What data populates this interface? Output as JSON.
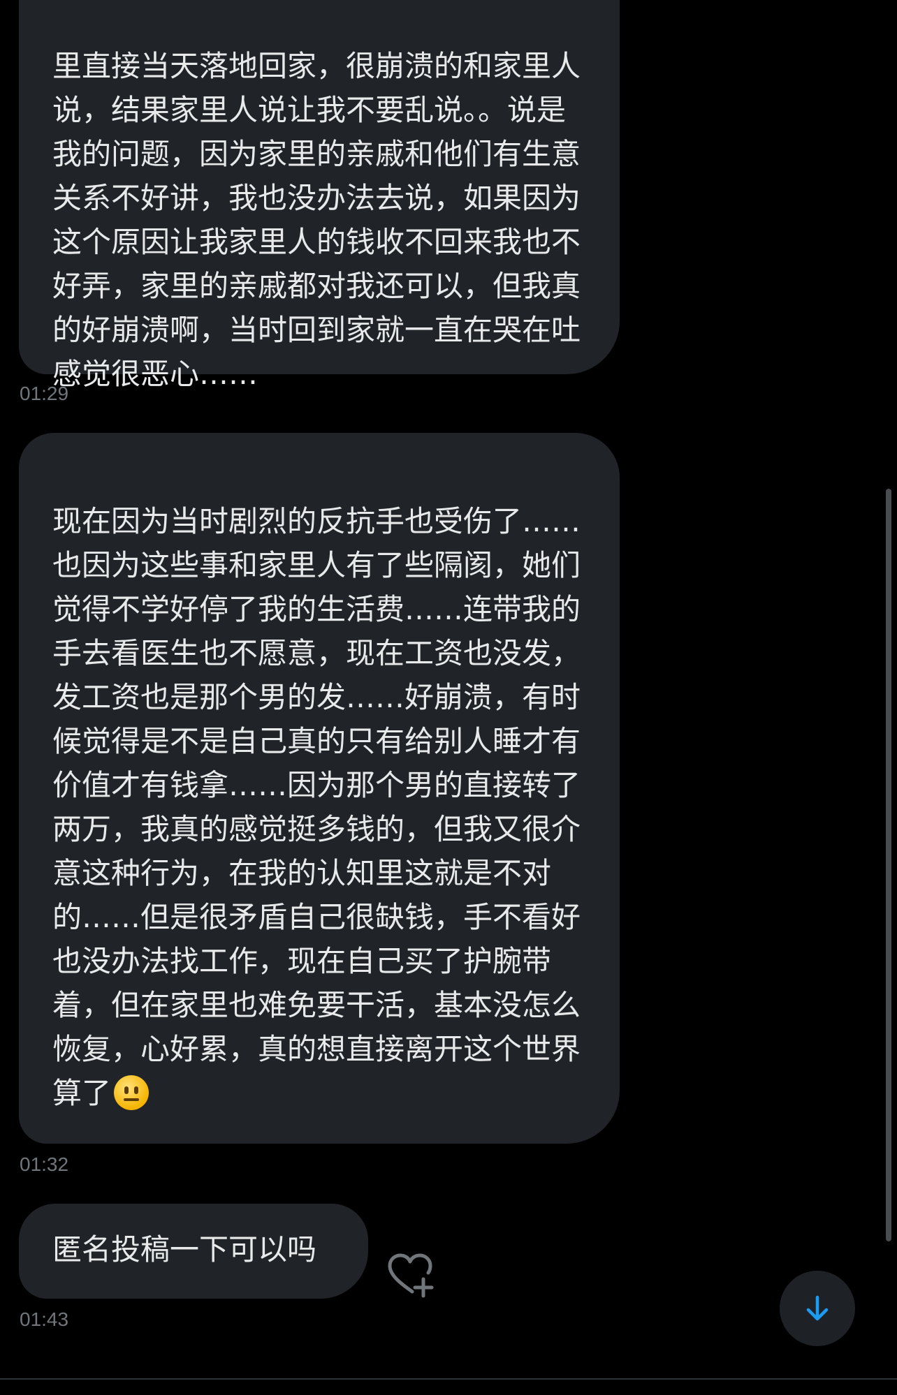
{
  "messages": [
    {
      "text": "里直接当天落地回家，很崩溃的和家里人说，结果家里人说让我不要乱说。。说是我的问题，因为家里的亲戚和他们有生意关系不好讲，我也没办法去说，如果因为这个原因让我家里人的钱收不回来我也不好弄，家里的亲戚都对我还可以，但我真的好崩溃啊，当时回到家就一直在哭在吐感觉很恶心……",
      "time": "01:29"
    },
    {
      "text": "现在因为当时剧烈的反抗手也受伤了……也因为这些事和家里人有了些隔阂，她们觉得不学好停了我的生活费……连带我的手去看医生也不愿意，现在工资也没发，发工资也是那个男的发……好崩溃，有时候觉得是不是自己真的只有给别人睡才有价值才有钱拿……因为那个男的直接转了两万，我真的感觉挺多钱的，但我又很介意这种行为，在我的认知里这就是不对的……但是很矛盾自己很缺钱，手不看好也没办法找工作，现在自己买了护腕带着，但在家里也难免要干活，基本没怎么恢复，心好累，真的想直接离开这个世界算了",
      "emoji": "neutral-face",
      "time": "01:32"
    },
    {
      "text": "匿名投稿一下可以吗",
      "time": "01:43"
    }
  ],
  "colors": {
    "background": "#000000",
    "bubble": "#202327",
    "text": "#e7e9ea",
    "timestamp": "#71767b",
    "accent": "#1d9bf0"
  },
  "icons": {
    "react": "heart-plus-icon",
    "scroll_down": "arrow-down-icon"
  }
}
